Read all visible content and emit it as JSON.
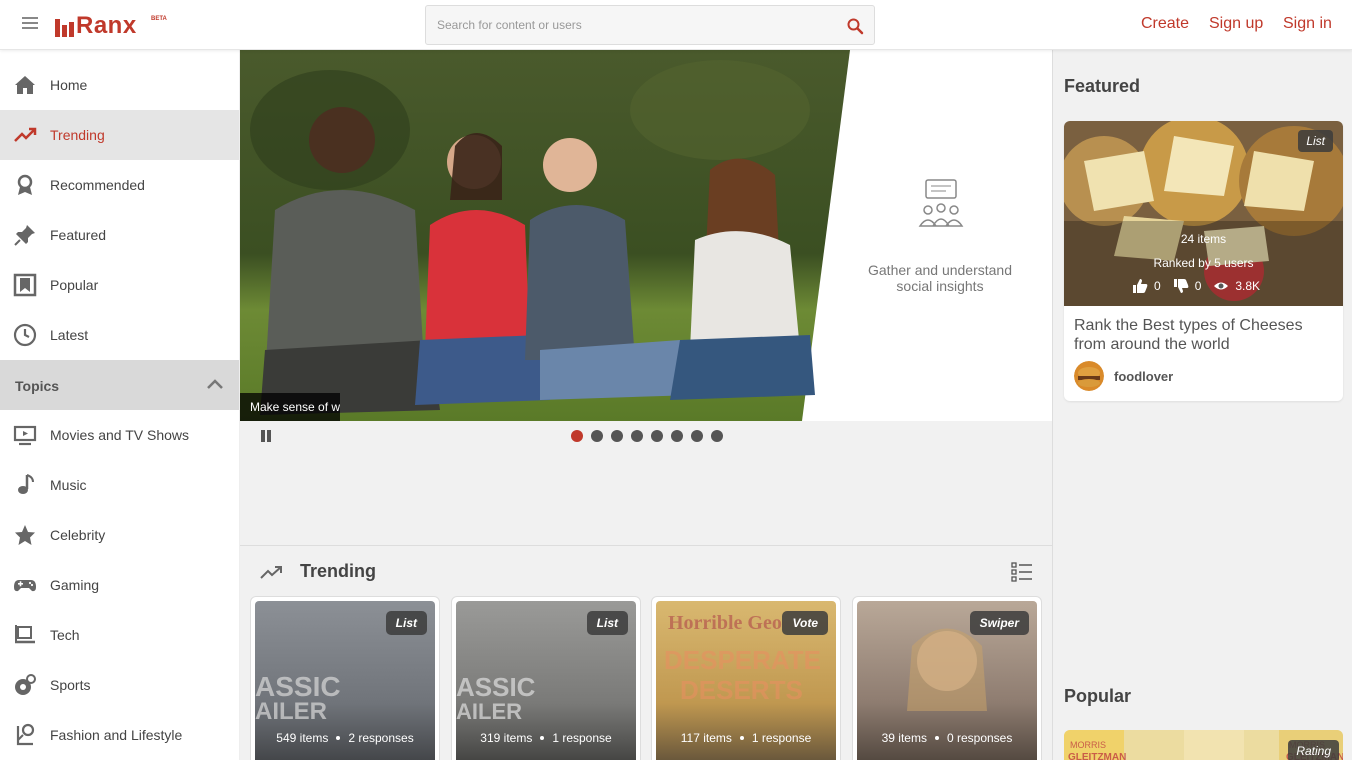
{
  "header": {
    "logo_text": "Ranx",
    "logo_badge": "BETA",
    "search_placeholder": "Search for content or users",
    "nav": {
      "create": "Create",
      "signup": "Sign up",
      "signin": "Sign in"
    },
    "accent_color": "#c0392b"
  },
  "sidebar": {
    "items": [
      {
        "label": "Home",
        "icon": "home-icon"
      },
      {
        "label": "Trending",
        "icon": "trending-icon",
        "active": true
      },
      {
        "label": "Recommended",
        "icon": "recommended-icon"
      },
      {
        "label": "Featured",
        "icon": "pin-icon"
      },
      {
        "label": "Popular",
        "icon": "popular-icon"
      },
      {
        "label": "Latest",
        "icon": "clock-icon"
      }
    ],
    "topics_label": "Topics",
    "topics": [
      {
        "label": "Movies and TV Shows",
        "icon": "tv-icon"
      },
      {
        "label": "Music",
        "icon": "music-icon"
      },
      {
        "label": "Celebrity",
        "icon": "star-icon"
      },
      {
        "label": "Gaming",
        "icon": "gamepad-icon"
      },
      {
        "label": "Tech",
        "icon": "tech-icon"
      },
      {
        "label": "Sports",
        "icon": "sports-icon"
      },
      {
        "label": "Fashion and Lifestyle",
        "icon": "fashion-icon"
      }
    ]
  },
  "hero": {
    "caption": "Make sense of w",
    "side_text": "Gather and understand social insights",
    "slide_count": 8,
    "active_slide": 1
  },
  "trending": {
    "title": "Trending",
    "cards": [
      {
        "badge": "List",
        "items": "549 items",
        "responses": "2 responses",
        "bg": "#7d8085",
        "overlay": "ASSIC\nAILER"
      },
      {
        "badge": "List",
        "items": "319 items",
        "responses": "1 response",
        "bg": "#8a8a88",
        "overlay": "ASSIC\nAILER"
      },
      {
        "badge": "Vote",
        "items": "117 items",
        "responses": "1 response",
        "bg": "#c7a25a",
        "overlay": "Horrible Geo\nDESPERATE\nDESERTS"
      },
      {
        "badge": "Swiper",
        "items": "39 items",
        "responses": "0 responses",
        "bg": "#9a8a7e",
        "overlay": ""
      }
    ]
  },
  "right": {
    "featured_title": "Featured",
    "featured": {
      "badge": "List",
      "items": "24 items",
      "ranked": "Ranked by 5 users",
      "likes": "0",
      "dislikes": "0",
      "views": "3.8K",
      "title": "Rank the Best types of Cheeses from around the world",
      "user": "foodlover"
    },
    "popular_title": "Popular",
    "popular_badge": "Rating"
  }
}
